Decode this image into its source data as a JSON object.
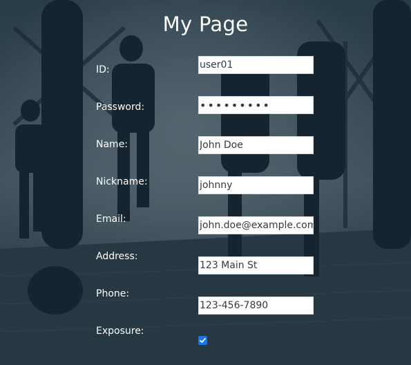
{
  "page": {
    "title": "My Page"
  },
  "form": {
    "id": {
      "label": "ID:",
      "value": "user01"
    },
    "password": {
      "label": "Password:",
      "masked_value": "•••••••••"
    },
    "name": {
      "label": "Name:",
      "value": "John Doe"
    },
    "nickname": {
      "label": "Nickname:",
      "value": "johnny"
    },
    "email": {
      "label": "Email:",
      "value": "john.doe@example.com"
    },
    "address": {
      "label": "Address:",
      "value": "123 Main St"
    },
    "phone": {
      "label": "Phone:",
      "value": "123-456-7890"
    },
    "exposure": {
      "label": "Exposure:",
      "checked": true
    }
  },
  "colors": {
    "overlay": "#12263a",
    "checkbox_accent": "#1a73e8",
    "text": "#ffffff"
  }
}
